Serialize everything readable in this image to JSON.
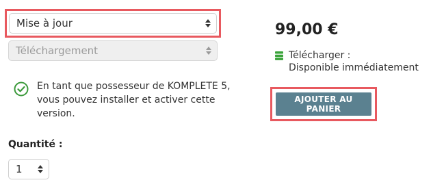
{
  "form": {
    "license_select": {
      "value": "Mise à jour"
    },
    "delivery_select": {
      "value": "Téléchargement"
    },
    "notice": "En tant que possesseur de KOMPLETE 5, vous pouvez installer et activer cette version.",
    "quantity_label": "Quantité :",
    "quantity_select": {
      "value": "1"
    }
  },
  "product": {
    "price": "99,00 €",
    "download_label": "Télécharger :",
    "availability": "Disponible immédiatement",
    "add_to_cart_label": "AJOUTER AU PANIER"
  },
  "icons": {
    "notice_icon": "check-circle-icon",
    "download_icon": "database-icon"
  },
  "colors": {
    "highlight": "#e8595f",
    "button": "#5b8190",
    "success": "#3c9a3c",
    "download_icon": "#3aa33a"
  }
}
